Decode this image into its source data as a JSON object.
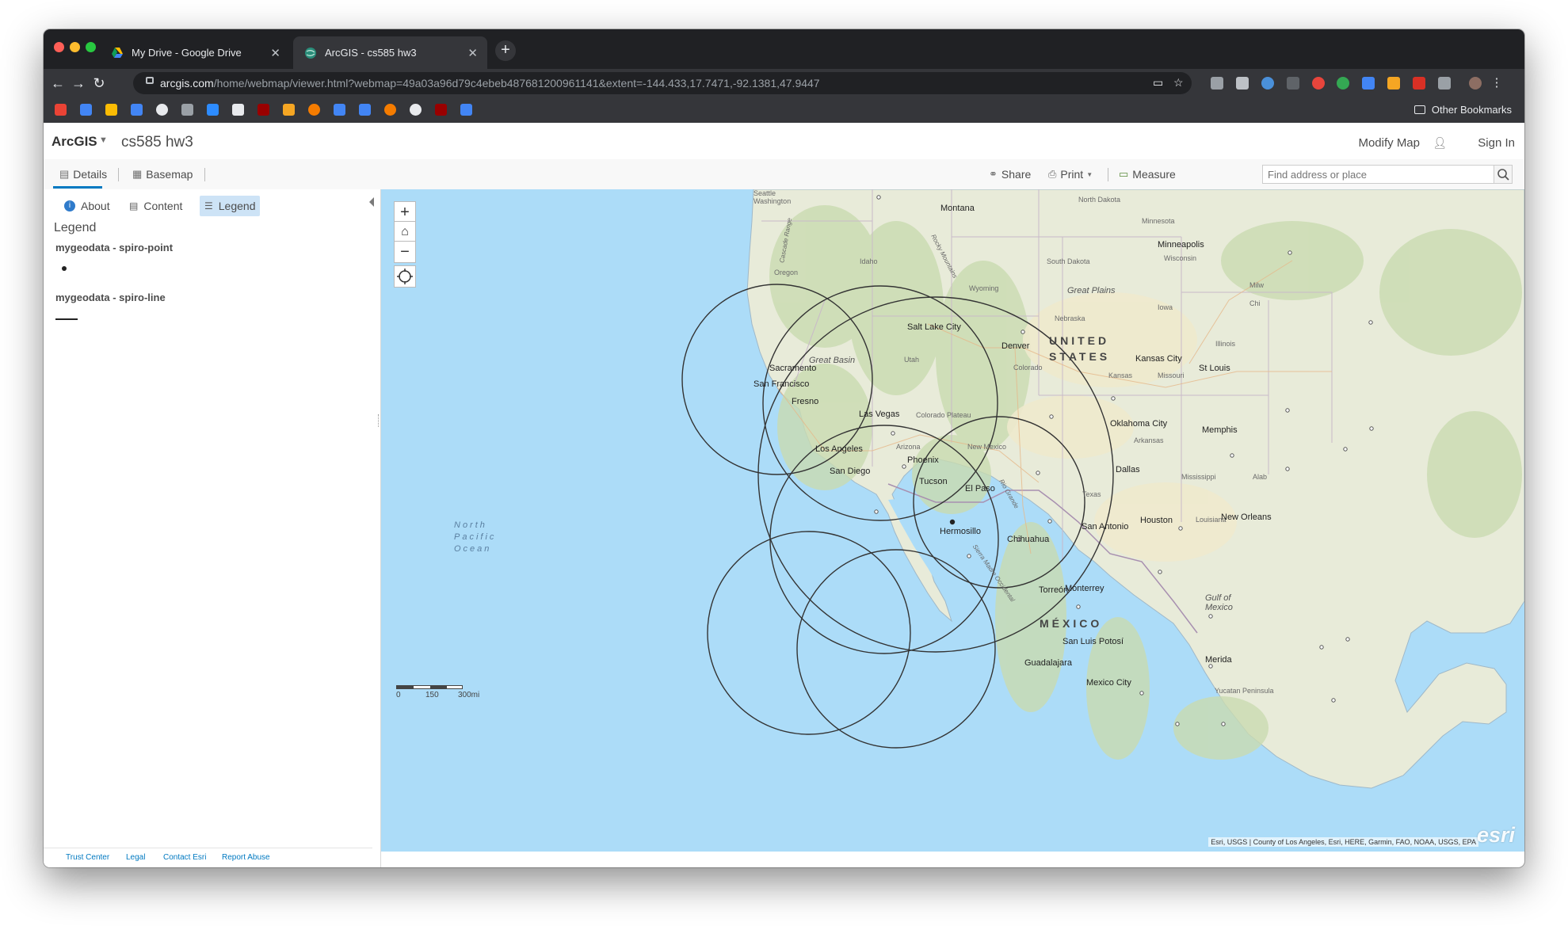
{
  "browser": {
    "tabs": [
      {
        "title": "My Drive - Google Drive"
      },
      {
        "title": "ArcGIS - cs585 hw3"
      }
    ],
    "url_domain": "arcgis.com",
    "url_path": "/home/webmap/viewer.html?webmap=49a03a96d79c4ebeb487681200961141&extent=-144.433,17.7471,-92.1381,47.9447",
    "other_bookmarks": "Other Bookmarks"
  },
  "app": {
    "logo": "ArcGIS",
    "map_title": "cs585 hw3",
    "modify_map": "Modify Map",
    "sign_in": "Sign In"
  },
  "subbar": {
    "details": "Details",
    "basemap": "Basemap",
    "share": "Share",
    "print": "Print",
    "measure": "Measure",
    "search_placeholder": "Find address or place"
  },
  "panel": {
    "tabs": [
      "About",
      "Content",
      "Legend"
    ],
    "legend_title": "Legend",
    "layers": [
      {
        "name": "mygeodata - spiro-point"
      },
      {
        "name": "mygeodata - spiro-line"
      }
    ],
    "footer": [
      "Trust Center",
      "Legal",
      "Contact Esri",
      "Report Abuse"
    ]
  },
  "map": {
    "places": [
      "Seattle",
      "Washington",
      "Montana",
      "North Dakota",
      "Minnesota",
      "Minneapolis",
      "Wisconsin",
      "Idaho",
      "Oregon",
      "Rocky Mountains",
      "Wyoming",
      "South Dakota",
      "Great Plains",
      "Nebraska",
      "Iowa",
      "Milw",
      "Chi",
      "Salt Lake City",
      "Denver",
      "UNITED",
      "STATES",
      "Illinois",
      "Kansas City",
      "St Louis",
      "Missouri",
      "Kansas",
      "Sacramento",
      "San Francisco",
      "Great Basin",
      "Utah",
      "Colorado",
      "Fresno",
      "Las Vegas",
      "Colorado Plateau",
      "Oklahoma City",
      "Memphis",
      "Arkansas",
      "Los Angeles",
      "Arizona",
      "Phoenix",
      "New Mexico",
      "Dallas",
      "Mississippi",
      "Alab",
      "San Diego",
      "Tucson",
      "El Paso",
      "Texas",
      "Houston",
      "Louisiana",
      "New Orleans",
      "San Antonio",
      "Hermosillo",
      "Chihuahua",
      "Torreón",
      "Monterrey",
      "MÉXICO",
      "San Luis Potosí",
      "Guadalajara",
      "Mexico City",
      "Merida",
      "Yucatan Peninsula",
      "Gulf of",
      "Mexico",
      "North",
      "Pacific",
      "Ocean",
      "Cascade Range",
      "Sierra Madre Occidental",
      "Rio Grande"
    ],
    "scale_labels": [
      "0",
      "150",
      "300mi"
    ],
    "attribution": "Esri, USGS | County of Los Angeles, Esri, HERE, Garmin, FAO, NOAA, USGS, EPA",
    "brand": "esri",
    "colors": {
      "ocean": "#acdcf8",
      "land": "#e6ead8",
      "circle_stroke": "#333333"
    }
  }
}
